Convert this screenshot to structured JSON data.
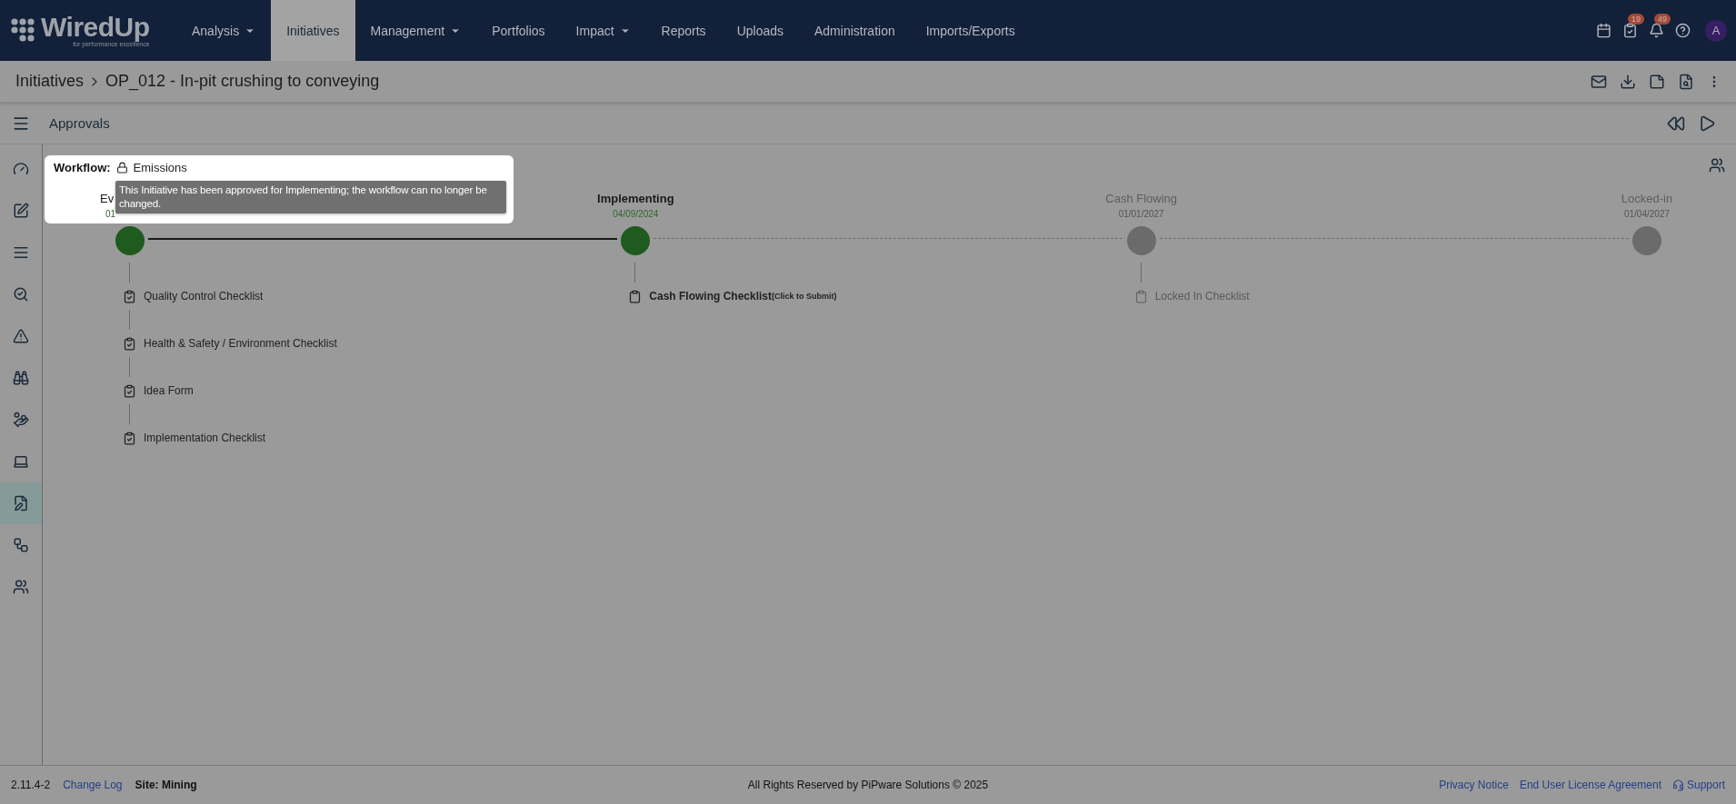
{
  "logo": {
    "name": "WiredUp",
    "tagline": "for performance excellence"
  },
  "nav": [
    {
      "label": "Analysis",
      "selected": false,
      "has_menu": true
    },
    {
      "label": "Initiatives",
      "selected": true,
      "has_menu": false
    },
    {
      "label": "Management",
      "selected": false,
      "has_menu": true
    },
    {
      "label": "Portfolios",
      "selected": false,
      "has_menu": false
    },
    {
      "label": "Impact",
      "selected": false,
      "has_menu": true
    },
    {
      "label": "Reports",
      "selected": false,
      "has_menu": false
    },
    {
      "label": "Uploads",
      "selected": false,
      "has_menu": false
    },
    {
      "label": "Administration",
      "selected": false,
      "has_menu": false
    },
    {
      "label": "Imports/Exports",
      "selected": false,
      "has_menu": false
    }
  ],
  "top_icons": [
    {
      "kind": "calendar"
    },
    {
      "kind": "tasks",
      "badge": "19"
    },
    {
      "kind": "bell",
      "badge": "49"
    },
    {
      "kind": "help"
    }
  ],
  "avatar": "A",
  "breadcrumb": {
    "parent": "Initiatives",
    "current": "OP_012 - In-pit crushing to conveying"
  },
  "page_actions": [
    {
      "kind": "mail"
    },
    {
      "kind": "download"
    },
    {
      "kind": "note"
    },
    {
      "kind": "doc-search"
    },
    {
      "kind": "more"
    }
  ],
  "section": {
    "title": "Approvals"
  },
  "sidebar": [
    {
      "kind": "gauge",
      "selected": false
    },
    {
      "kind": "edit",
      "selected": false
    },
    {
      "kind": "list",
      "selected": false
    },
    {
      "kind": "search",
      "selected": false
    },
    {
      "kind": "warning",
      "selected": false
    },
    {
      "kind": "binoculars",
      "selected": false
    },
    {
      "kind": "hand-coins",
      "selected": false
    },
    {
      "kind": "laptop",
      "selected": false
    },
    {
      "kind": "file-pen",
      "selected": true
    },
    {
      "kind": "workflow",
      "selected": false
    },
    {
      "kind": "users",
      "selected": false
    }
  ],
  "workflow": {
    "label": "Workflow:",
    "value": "Emissions",
    "locked": true,
    "tooltip": "This Initiative has been approved for Implementing; the workflow can no longer be changed."
  },
  "stages": [
    {
      "name": "Ev",
      "date": "01",
      "kind": "completed",
      "checklists": [
        {
          "label": "Quality Control Checklist",
          "kind": "done"
        },
        {
          "label": "Health & Safety / Environment Checklist",
          "kind": "done"
        },
        {
          "label": "Idea Form",
          "kind": "done"
        },
        {
          "label": "Implementation Checklist",
          "kind": "done"
        }
      ]
    },
    {
      "name": "Implementing",
      "date": "04/09/2024",
      "kind": "current",
      "checklists": [
        {
          "label": "Cash Flowing Checklist",
          "note": "(Click to Submit)",
          "kind": "pending"
        }
      ]
    },
    {
      "name": "Cash Flowing",
      "date": "01/01/2027",
      "kind": "future",
      "checklists": [
        {
          "label": "Locked In Checklist",
          "kind": "locked"
        }
      ]
    },
    {
      "name": "Locked-in",
      "date": "01/04/2027",
      "kind": "future"
    }
  ],
  "footer": {
    "version": "2.11.4-2",
    "change_log": "Change Log",
    "site": "Site: Mining",
    "copyright": "All Rights Reserved by PiPware Solutions © 2025",
    "links": [
      "Privacy Notice",
      "End User License Agreement"
    ],
    "support": "Support"
  }
}
